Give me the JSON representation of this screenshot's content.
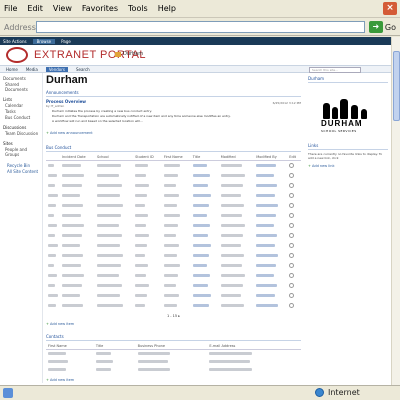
{
  "browser": {
    "menu": [
      "File",
      "Edit",
      "View",
      "Favorites",
      "Tools",
      "Help"
    ],
    "address_label": "Address",
    "go_label": "Go",
    "status_zone": "Internet"
  },
  "site": {
    "topbar_tabs": [
      "Site Actions",
      "Browse",
      "Page"
    ],
    "portal_title": "EXTRANET PORTAL",
    "breadcrumb": "Durham",
    "nav_tabs": [
      "Home",
      "Media",
      "Vendors",
      "Search"
    ],
    "search_placeholder": "Search this site..."
  },
  "quicklaunch": {
    "documents_header": "Documents",
    "documents_items": [
      "Shared Documents"
    ],
    "lists_header": "Lists",
    "lists_items": [
      "Calendar",
      "Tasks",
      "Bus Conduct"
    ],
    "discussions_header": "Discussions",
    "discussions_items": [
      "Team Discussion"
    ],
    "sites_header": "Sites",
    "people_header": "People and Groups",
    "footer_items": [
      "Recycle Bin",
      "All Site Content"
    ]
  },
  "page": {
    "title": "Durham",
    "announcements_title": "Announcements",
    "announcement_heading": "Process Overview",
    "announcement_by": "by IT_admin",
    "announcement_date": "6/25/2012 3:12 PM",
    "announcement_lines": [
      "Durham initiates the process by creating a new bus conduct entry.",
      "Durham and the Transportation are automatically notified of a new item and any time someone else modifies an entry.",
      "A workflow will run and based on the selected location will..."
    ],
    "add_announcement": "Add new announcement",
    "bus_conduct_title": "Bus Conduct",
    "bus_conduct_columns": [
      "Incident Date",
      "School",
      "Student ID",
      "First Name",
      "Title",
      "Modified",
      "Modified By",
      "Edit"
    ],
    "bus_conduct_row_count": 15,
    "pager": "1 - 15",
    "add_item": "Add new item",
    "contacts_title": "Contacts",
    "contacts_columns": [
      "First Name",
      "Title",
      "Business Phone",
      "E-mail Address"
    ],
    "contacts_row_count": 3,
    "add_contact": "Add new item"
  },
  "rightcol": {
    "durham_title": "Durham",
    "logo_word": "DURHAM",
    "logo_sub": "SCHOOL SERVICES",
    "links_title": "Links",
    "links_empty": "There are currently no favorite links to display. To add a new link, click",
    "add_link": "Add new link"
  }
}
